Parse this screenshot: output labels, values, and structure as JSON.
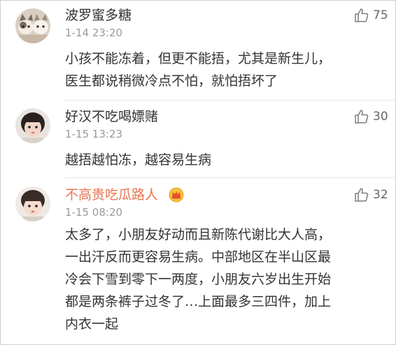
{
  "comments": [
    {
      "username": "波罗蜜多糖",
      "time": "1-14 23:20",
      "likes": "75",
      "lines": [
        "小孩不能冻着，但更不能捂，尤其是新生儿，",
        "医生都说稍微冷点不怕，就怕捂坏了"
      ],
      "avatar_icon": "two-cats-avatar-icon"
    },
    {
      "username": "好汉不吃喝嫖赌",
      "time": "1-15 13:23",
      "likes": "30",
      "lines": [
        "越捂越怕冻，越容易生病"
      ],
      "avatar_icon": "girl-avatar-icon"
    },
    {
      "username": "不高贵吃瓜路人",
      "time": "1-15 08:20",
      "likes": "32",
      "lines": [
        "太多了，小朋友好动而且新陈代谢比大人高，",
        "一出汗反而更容易生病。中部地区在半山区最",
        "冷会下雪到零下一两度，小朋友六岁出生开始",
        "都是两条裤子过冬了…上面最多三四件，加上",
        "内衣一起"
      ],
      "avatar_icon": "child-avatar-icon",
      "badge_icon": "crown-badge-icon"
    }
  ],
  "colors": {
    "vip_name": "#eb7350",
    "name": "#333333",
    "meta": "#9a9a9a",
    "divider": "#e6e6e6"
  }
}
